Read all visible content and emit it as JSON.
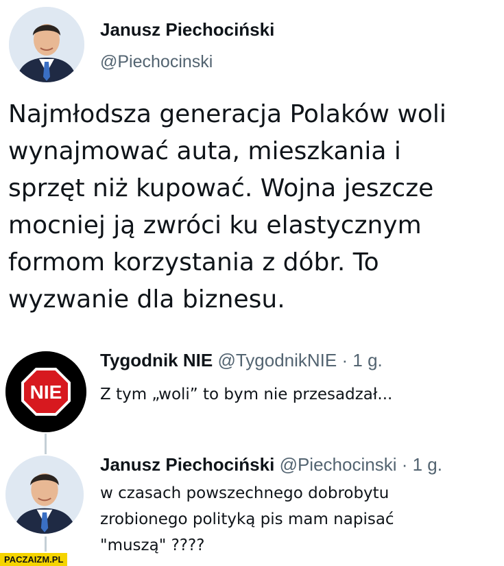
{
  "main_tweet": {
    "author_name": "Janusz Piechociński",
    "author_handle": "@Piechocinski",
    "avatar_icon": "person-portrait-icon",
    "text_lines": [
      "Najmłodsza generacja Polaków woli",
      "wynajmować auta, mieszkania i",
      "sprzęt niż kupować. Wojna jeszcze",
      "mocniej ją zwróci ku elastycznym",
      "formom korzystania z dóbr. To",
      "wyzwanie dla biznesu."
    ]
  },
  "replies": [
    {
      "author_name": "Tygodnik NIE",
      "author_handle": "@TygodnikNIE",
      "separator": "·",
      "time": "1 g.",
      "avatar_text": "NIE",
      "avatar_icon": "stop-sign-icon",
      "text_lines": [
        "Z tym „woli” to bym nie przesadzał..."
      ]
    },
    {
      "author_name": "Janusz Piechociński",
      "author_handle": "@Piechocinski",
      "separator": "·",
      "time": "1 g.",
      "avatar_icon": "person-portrait-icon",
      "text_lines": [
        "w czasach powszechnego dobrobytu",
        "zrobionego polityką pis mam napisać",
        "\"muszą\" ????"
      ]
    }
  ],
  "watermark": "PACZAIZM.PL",
  "colors": {
    "text": "#0f1419",
    "secondary": "#536471",
    "thread_line": "#c4cfd6",
    "stop_sign_red": "#d7191f",
    "watermark_bg": "#f5d400"
  }
}
